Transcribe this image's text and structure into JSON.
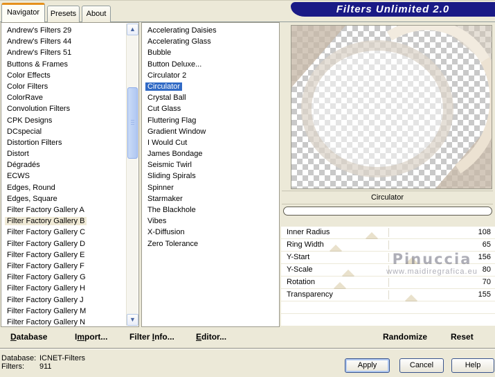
{
  "window": {
    "banner_title": "Filters Unlimited 2.0"
  },
  "tabs": [
    {
      "label": "Navigator",
      "active": true
    },
    {
      "label": "Presets",
      "active": false
    },
    {
      "label": "About",
      "active": false
    }
  ],
  "navigator_list": {
    "selected_index": 17,
    "items": [
      "Andrew's Filters 29",
      "Andrew's Filters 44",
      "Andrew's Filters 51",
      "Buttons & Frames",
      "Color Effects",
      "Color Filters",
      "ColorRave",
      "Convolution Filters",
      "CPK Designs",
      "DCspecial",
      "Distortion Filters",
      "Distort",
      "Dégradés",
      "ECWS",
      "Edges, Round",
      "Edges, Square",
      "Filter Factory Gallery A",
      "Filter Factory Gallery B",
      "Filter Factory Gallery C",
      "Filter Factory Gallery D",
      "Filter Factory Gallery E",
      "Filter Factory Gallery F",
      "Filter Factory Gallery G",
      "Filter Factory Gallery H",
      "Filter Factory Gallery J",
      "Filter Factory Gallery M",
      "Filter Factory Gallery N"
    ]
  },
  "filters_list": {
    "selected_index": 5,
    "items": [
      "Accelerating Daisies",
      "Accelerating Glass",
      "Bubble",
      "Button Deluxe...",
      "Circulator 2",
      "Circulator",
      "Crystal Ball",
      "Cut Glass",
      "Fluttering Flag",
      "Gradient Window",
      "I Would Cut",
      "James Bondage",
      "Seismic Twirl",
      "Sliding Spirals",
      "Spinner",
      "Starmaker",
      "The Blackhole",
      "Vibes",
      "X-Diffusion",
      "Zero Tolerance"
    ]
  },
  "preview": {
    "caption": "Circulator",
    "progress_value": 0
  },
  "slider_max": 255,
  "sliders": [
    {
      "label": "Inner Radius",
      "value": 108
    },
    {
      "label": "Ring Width",
      "value": 65
    },
    {
      "label": "Y-Start",
      "value": 156
    },
    {
      "label": "Y-Scale",
      "value": 80
    },
    {
      "label": "Rotation",
      "value": 70
    },
    {
      "label": "Transparency",
      "value": 155
    }
  ],
  "watermark": {
    "line1": "Pinuccia",
    "line2": "www.maidiregrafica.eu"
  },
  "menu": [
    {
      "label": "Database",
      "underline": 0
    },
    {
      "label": "Import...",
      "underline": 1
    },
    {
      "label": "Filter Info...",
      "underline": 7
    },
    {
      "label": "Editor...",
      "underline": 0
    }
  ],
  "actions": [
    {
      "label": "Randomize"
    },
    {
      "label": "Reset"
    }
  ],
  "status": {
    "database_label": "Database:",
    "database_value": "ICNET-Filters",
    "filters_label": "Filters:",
    "filters_value": "911"
  },
  "buttons": [
    {
      "label": "Apply",
      "default": true
    },
    {
      "label": "Cancel",
      "default": false
    },
    {
      "label": "Help",
      "default": false
    }
  ],
  "colors": {
    "banner_blue": "#1a1a86",
    "selection_blue": "#316ac5",
    "selection_beige": "#f0ead6",
    "tab_accent_orange": "#e5901c",
    "dialog_beige": "#ece9d8"
  }
}
